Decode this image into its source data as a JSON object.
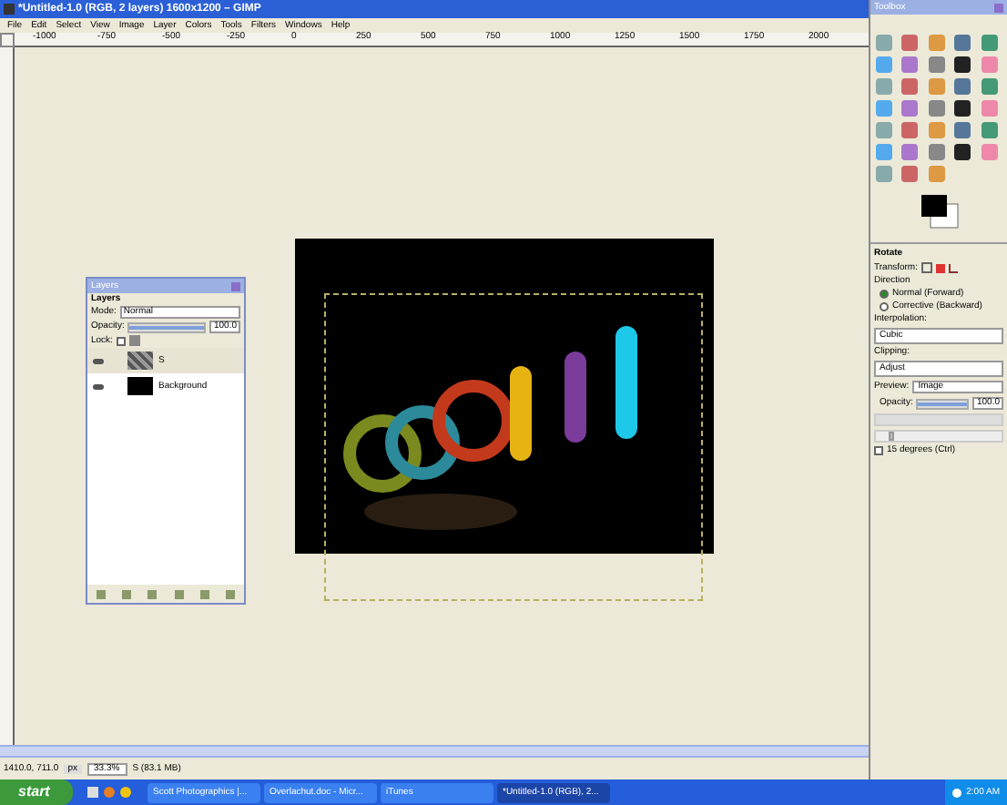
{
  "window": {
    "title": "*Untitled-1.0 (RGB, 2 layers) 1600x1200 – GIMP"
  },
  "menu": [
    "File",
    "Edit",
    "Select",
    "View",
    "Image",
    "Layer",
    "Colors",
    "Tools",
    "Filters",
    "Windows",
    "Help"
  ],
  "ruler": [
    "-1000",
    "-750",
    "-500",
    "-250",
    "0",
    "250",
    "500",
    "750",
    "1000",
    "1250",
    "1500",
    "1750",
    "2000"
  ],
  "layers_dialog": {
    "title": "Layers",
    "header": "Layers",
    "mode_label": "Mode:",
    "mode": "Normal",
    "opacity_label": "Opacity:",
    "opacity": "100.0",
    "opacity_slider": {
      "level": 1
    },
    "lock_label": "Lock:",
    "lock_pixels": {
      "checked": false
    },
    "layers": [
      {
        "name": "S",
        "kind": "text",
        "selected": true
      },
      {
        "name": "Background",
        "kind": "fill",
        "selected": false
      }
    ]
  },
  "toolbox": {
    "title": "Toolbox"
  },
  "tool_options": {
    "title": "Rotate",
    "transform_label": "Transform:",
    "direction_label": "Direction",
    "directions": [
      {
        "label": "Normal (Forward)",
        "selected": true
      },
      {
        "label": "Corrective (Backward)",
        "selected": false
      }
    ],
    "interpolation_label": "Interpolation:",
    "interpolation": "Cubic",
    "clipping_label": "Clipping:",
    "clipping": "Adjust",
    "preview_label": "Preview:",
    "preview": "Image",
    "opacity_label": "Opacity:",
    "opacity": "100.0",
    "opacity_slider": {
      "level": 1
    },
    "grid_slider": {
      "level": 0.1
    },
    "constrain": {
      "label": "15 degrees (Ctrl)",
      "checked": false
    }
  },
  "status_bar": {
    "coords": "1410.0, 711.0",
    "unit": "px",
    "zoom": "33.3%",
    "layer": "S (83.1 MB)"
  },
  "taskbar": {
    "start": "start",
    "tasks": [
      {
        "label": "Scott Photographics |...",
        "selected": false
      },
      {
        "label": "Overlachut.doc - Micr...",
        "selected": false
      },
      {
        "label": "iTunes",
        "selected": false
      },
      {
        "label": "*Untitled-1.0 (RGB), 2...",
        "selected": true
      }
    ],
    "clock": "2:00 AM"
  }
}
